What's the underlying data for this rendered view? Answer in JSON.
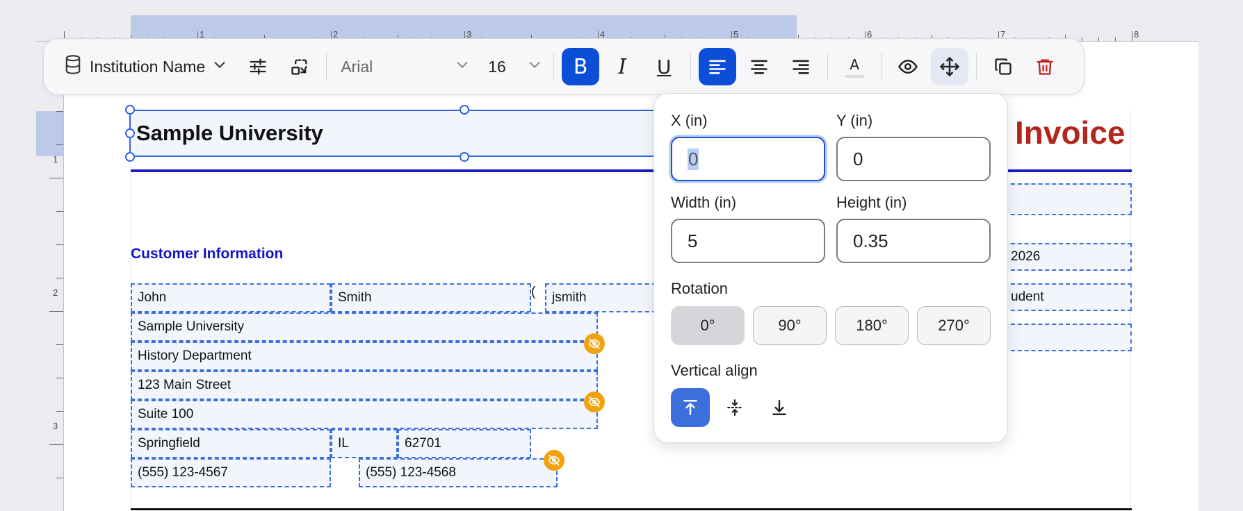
{
  "toolbar": {
    "field_name": "Institution Name",
    "font_family": "Arial",
    "font_size": "16",
    "bold_active": true,
    "align_left_active": true
  },
  "ruler": {
    "top_numbers": [
      "1",
      "2",
      "3",
      "4",
      "5",
      "6",
      "7",
      "8"
    ],
    "left_numbers": [
      "1",
      "2",
      "3"
    ]
  },
  "document": {
    "institution_name": "Sample University",
    "invoice_title": "Invoice",
    "customer_heading": "Customer Information",
    "first_name": "John",
    "last_name": "Smith",
    "paren": "(",
    "username": "jsmith",
    "right_date_partial": "2026",
    "right_role_partial": "udent",
    "institution": "Sample University",
    "department": "History Department",
    "street": "123 Main Street",
    "suite": "Suite 100",
    "city": "Springfield",
    "state": "IL",
    "zip": "62701",
    "phone": "(555) 123-4567",
    "phone2": "(555) 123-4568"
  },
  "popover": {
    "x_label": "X (in)",
    "x_value": "0",
    "y_label": "Y (in)",
    "y_value": "0",
    "width_label": "Width (in)",
    "width_value": "5",
    "height_label": "Height (in)",
    "height_value": "0.35",
    "rotation_label": "Rotation",
    "rotation_options": [
      "0°",
      "90°",
      "180°",
      "270°"
    ],
    "rotation_selected": "0°",
    "valign_label": "Vertical align",
    "valign_selected": "top"
  },
  "colors": {
    "accent": "#0c4fd6",
    "invoice_red": "#b3261e",
    "heading_blue": "#1515c8",
    "hidden_badge": "#f2a20c",
    "delete_red": "#c0201a"
  }
}
